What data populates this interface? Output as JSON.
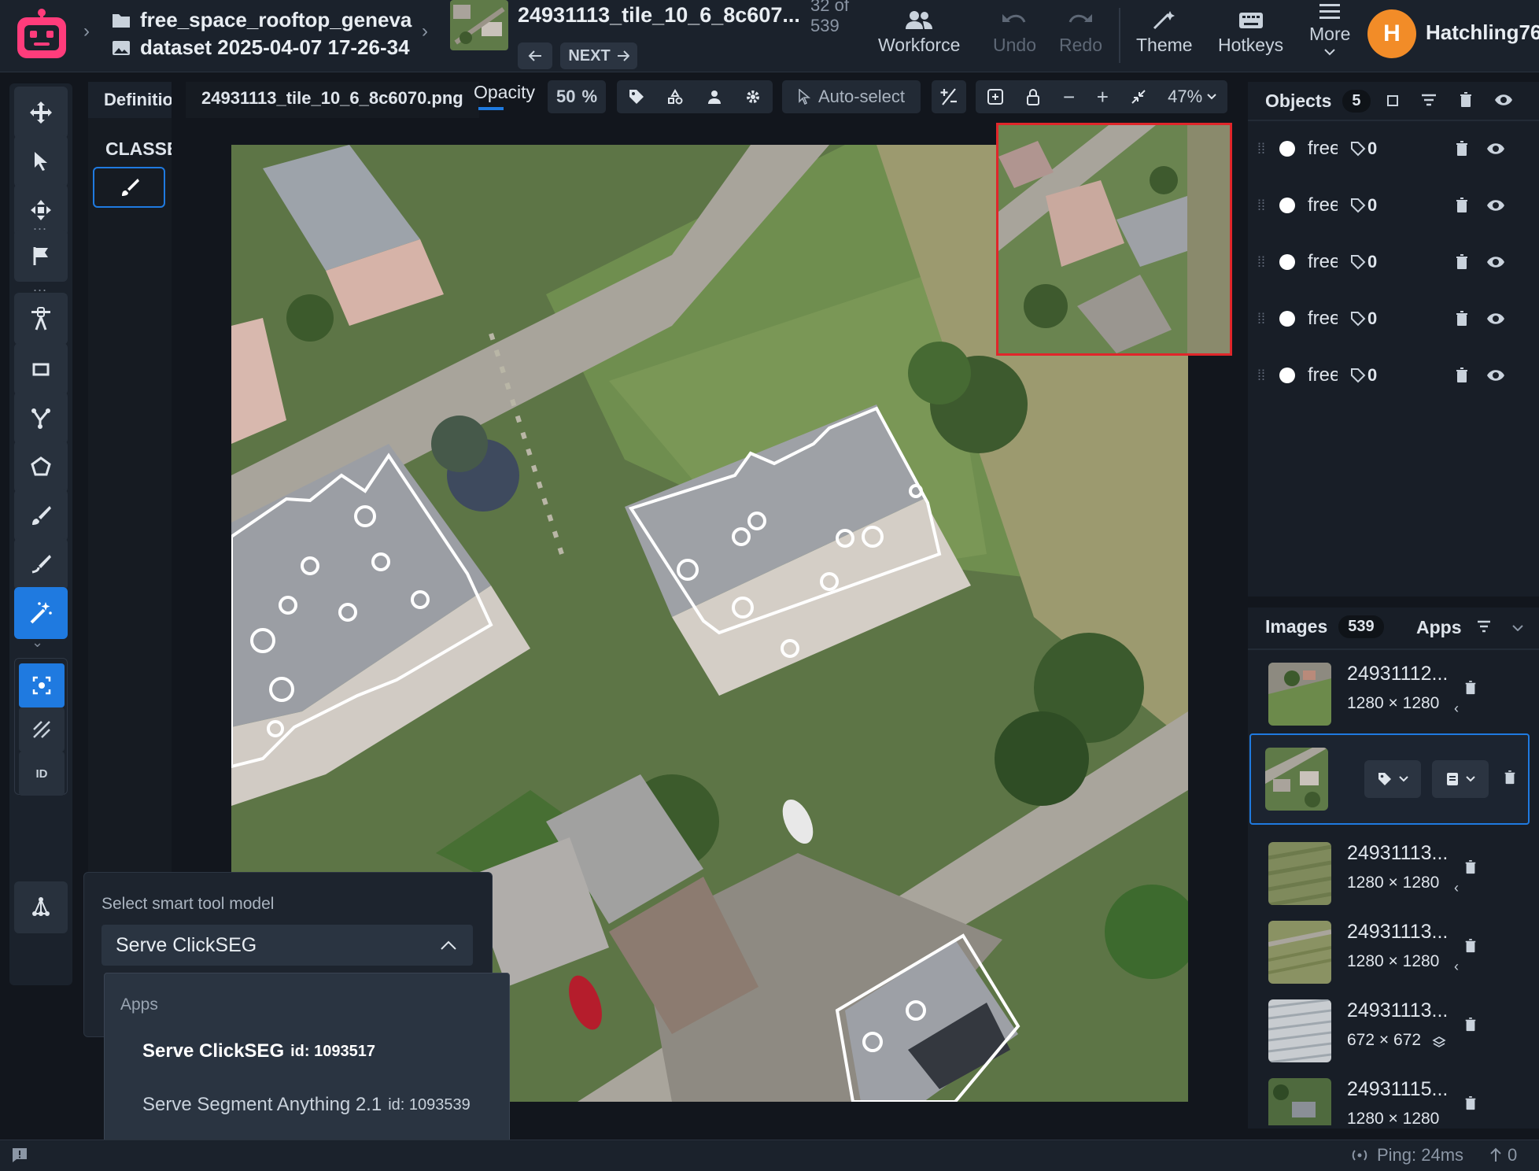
{
  "header": {
    "project_name": "free_space_rooftop_geneva",
    "dataset_name": "dataset 2025-04-07 17-26-34",
    "image_title": "24931113_tile_10_6_8c607...",
    "image_position": "32 of\n539",
    "next_label": "NEXT",
    "actions": {
      "workforce": "Workforce",
      "undo": "Undo",
      "redo": "Redo",
      "theme": "Theme",
      "hotkeys": "Hotkeys",
      "more": "More"
    },
    "user": {
      "initial": "H",
      "name": "Hatchling76",
      "avatar_color": "#f28c28"
    }
  },
  "definitions": {
    "tab_label": "Definitions",
    "classes_label": "CLASSES"
  },
  "image_toolbar": {
    "filename": "24931113_tile_10_6_8c6070.png",
    "opacity_label": "Opacity",
    "opacity_value": "50",
    "opacity_unit": "%",
    "auto_select_label": "Auto-select",
    "zoom_level": "47%"
  },
  "objects_panel": {
    "title": "Objects",
    "count": "5",
    "items": [
      {
        "label": "free",
        "tag_count": "0"
      },
      {
        "label": "free",
        "tag_count": "0"
      },
      {
        "label": "free",
        "tag_count": "0"
      },
      {
        "label": "free",
        "tag_count": "0"
      },
      {
        "label": "free",
        "tag_count": "0"
      }
    ]
  },
  "images_panel": {
    "title": "Images",
    "count": "539",
    "apps_tab": "Apps",
    "items": [
      {
        "name": "24931112...",
        "dims": "1280 × 1280",
        "selected": false
      },
      {
        "name": "",
        "dims": "",
        "selected": true
      },
      {
        "name": "24931113...",
        "dims": "1280 × 1280",
        "selected": false
      },
      {
        "name": "24931113...",
        "dims": "1280 × 1280",
        "selected": false
      },
      {
        "name": "24931113...",
        "dims": "672 × 672",
        "selected": false
      },
      {
        "name": "24931115...",
        "dims": "1280 × 1280",
        "selected": false
      }
    ]
  },
  "smart_tool": {
    "label": "Select smart tool model",
    "selected": "Serve ClickSEG",
    "menu_group": "Apps",
    "options": [
      {
        "name": "Serve ClickSEG",
        "id": "id: 1093517",
        "active": true
      },
      {
        "name": "Serve Segment Anything 2.1",
        "id": "id: 1093539",
        "active": false
      }
    ]
  },
  "toolbar": {
    "id_label": "ID"
  },
  "status": {
    "ping": "Ping: 24ms",
    "uploads": "0"
  },
  "colors": {
    "accent": "#1f7ae0",
    "minimap_border": "#e0262a",
    "annotation_outline": "#ffffff"
  }
}
